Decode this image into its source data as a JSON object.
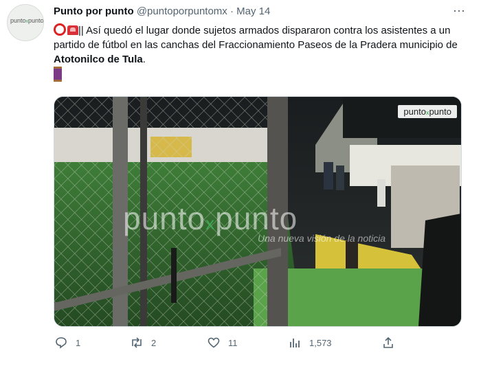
{
  "tweet": {
    "author_name": "Punto por punto",
    "handle": "@puntoporpuntomx",
    "separator": "·",
    "date": "May 14",
    "text_part1": "|| Así quedó el lugar donde sujetos armados dispararon contra los asistentes a un partido de fútbol en las canchas del Fraccionamiento Paseos de la Pradera municipio de ",
    "text_bold": "Atotonilco de Tula",
    "text_part2": ".",
    "more_icon": "⋯"
  },
  "avatar": {
    "logo_text_left": "punto",
    "logo_x": "x",
    "logo_text_right": "punto"
  },
  "media": {
    "corner_logo_left": "punto",
    "corner_logo_x": "x",
    "corner_logo_right": "punto",
    "watermark_left": "punto",
    "watermark_x": "x",
    "watermark_right": "punto",
    "watermark_tagline": "Una nueva visión de la noticia"
  },
  "actions": {
    "reply_count": "1",
    "retweet_count": "2",
    "like_count": "11",
    "views_count": "1,573"
  },
  "colors": {
    "secondary_text": "#536471",
    "brand_green": "#2aa84a",
    "field_green": "#3f8a3a"
  }
}
